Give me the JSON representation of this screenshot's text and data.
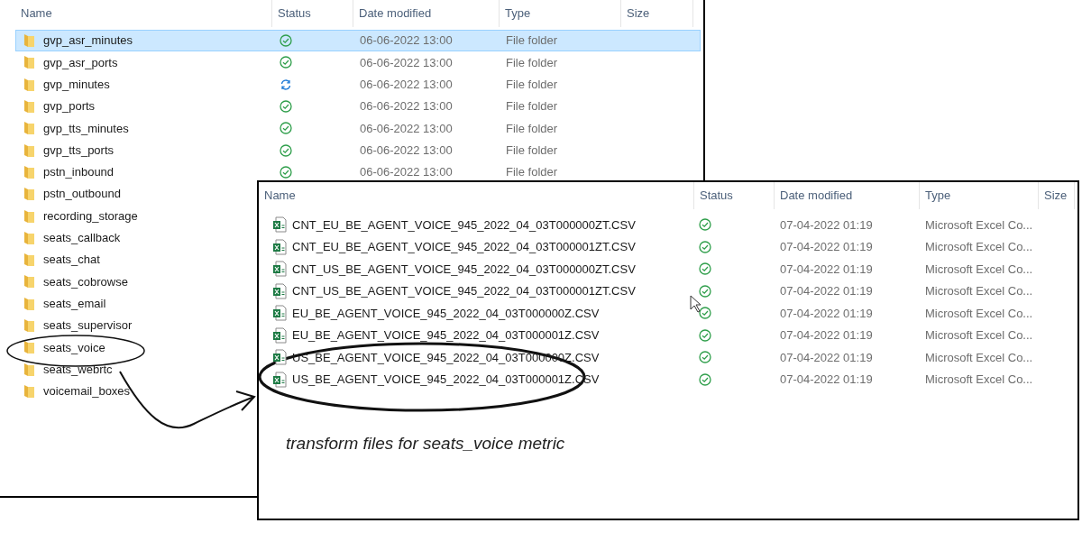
{
  "folder_window": {
    "columns": [
      "Name",
      "Status",
      "Date modified",
      "Type",
      "Size"
    ],
    "rows": [
      {
        "name": "gvp_asr_minutes",
        "selected": true,
        "kind": "synced",
        "date": "06-06-2022 13:00",
        "type": "File folder"
      },
      {
        "name": "gvp_asr_ports",
        "selected": false,
        "kind": "synced",
        "date": "06-06-2022 13:00",
        "type": "File folder"
      },
      {
        "name": "gvp_minutes",
        "selected": false,
        "kind": "syncing",
        "date": "06-06-2022 13:00",
        "type": "File folder"
      },
      {
        "name": "gvp_ports",
        "selected": false,
        "kind": "synced",
        "date": "06-06-2022 13:00",
        "type": "File folder"
      },
      {
        "name": "gvp_tts_minutes",
        "selected": false,
        "kind": "synced",
        "date": "06-06-2022 13:00",
        "type": "File folder"
      },
      {
        "name": "gvp_tts_ports",
        "selected": false,
        "kind": "synced",
        "date": "06-06-2022 13:00",
        "type": "File folder"
      },
      {
        "name": "pstn_inbound",
        "selected": false,
        "kind": "synced",
        "date": "06-06-2022 13:00",
        "type": "File folder"
      },
      {
        "name": "pstn_outbound",
        "selected": false
      },
      {
        "name": "recording_storage",
        "selected": false
      },
      {
        "name": "seats_callback",
        "selected": false
      },
      {
        "name": "seats_chat",
        "selected": false
      },
      {
        "name": "seats_cobrowse",
        "selected": false
      },
      {
        "name": "seats_email",
        "selected": false
      },
      {
        "name": "seats_supervisor",
        "selected": false
      },
      {
        "name": "seats_voice",
        "selected": false
      },
      {
        "name": "seats_webrtc",
        "selected": false
      },
      {
        "name": "voicemail_boxes",
        "selected": false
      }
    ]
  },
  "files_window": {
    "columns": [
      "Name",
      "Status",
      "Date modified",
      "Type",
      "Size"
    ],
    "rows": [
      {
        "name": "CNT_EU_BE_AGENT_VOICE_945_2022_04_03T000000ZT.CSV",
        "kind": "synced",
        "date": "07-04-2022 01:19",
        "type": "Microsoft Excel Co..."
      },
      {
        "name": "CNT_EU_BE_AGENT_VOICE_945_2022_04_03T000001ZT.CSV",
        "kind": "synced",
        "date": "07-04-2022 01:19",
        "type": "Microsoft Excel Co..."
      },
      {
        "name": "CNT_US_BE_AGENT_VOICE_945_2022_04_03T000000ZT.CSV",
        "kind": "synced",
        "date": "07-04-2022 01:19",
        "type": "Microsoft Excel Co..."
      },
      {
        "name": "CNT_US_BE_AGENT_VOICE_945_2022_04_03T000001ZT.CSV",
        "kind": "synced",
        "date": "07-04-2022 01:19",
        "type": "Microsoft Excel Co..."
      },
      {
        "name": "EU_BE_AGENT_VOICE_945_2022_04_03T000000Z.CSV",
        "kind": "synced",
        "date": "07-04-2022 01:19",
        "type": "Microsoft Excel Co..."
      },
      {
        "name": "EU_BE_AGENT_VOICE_945_2022_04_03T000001Z.CSV",
        "kind": "synced",
        "date": "07-04-2022 01:19",
        "type": "Microsoft Excel Co..."
      },
      {
        "name": "US_BE_AGENT_VOICE_945_2022_04_03T000000Z.CSV",
        "kind": "synced",
        "date": "07-04-2022 01:19",
        "type": "Microsoft Excel Co..."
      },
      {
        "name": "US_BE_AGENT_VOICE_945_2022_04_03T000001Z.CSV",
        "kind": "synced",
        "date": "07-04-2022 01:19",
        "type": "Microsoft Excel Co..."
      }
    ],
    "caption": "transform files for seats_voice metric"
  }
}
